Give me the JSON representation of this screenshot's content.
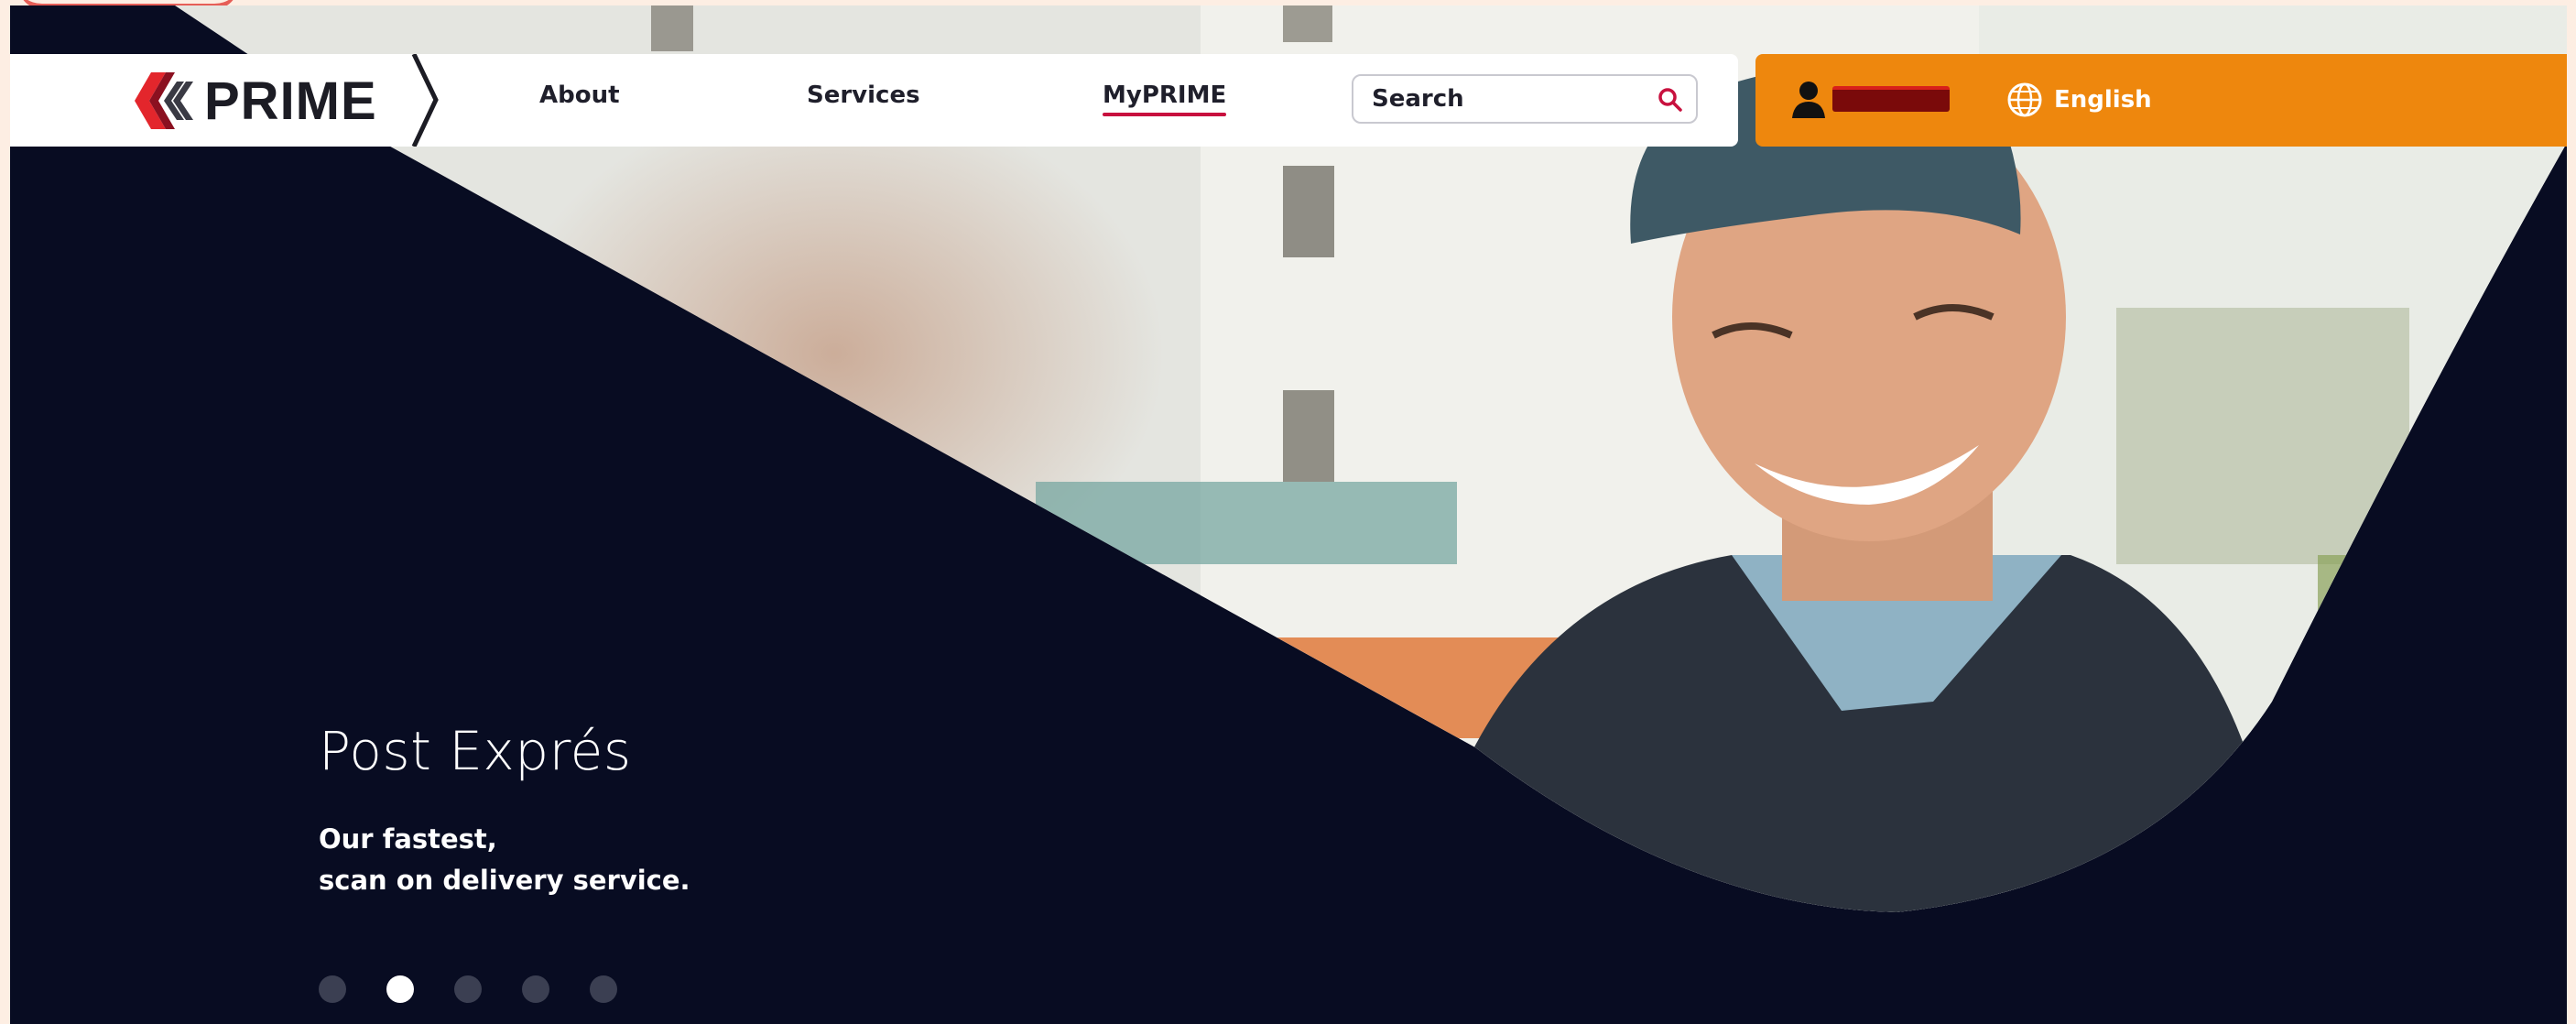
{
  "brand": {
    "name": "PRIME",
    "accent_color": "#c8103e",
    "orange_color": "#ee870d"
  },
  "nav": {
    "links": [
      {
        "label": "About"
      },
      {
        "label": "Services"
      },
      {
        "label": "MyPRIME",
        "active": true
      }
    ],
    "search": {
      "placeholder": "Search",
      "icon": "search-icon"
    }
  },
  "account": {
    "user_icon": "user-icon",
    "language_icon": "globe-icon",
    "language": "English"
  },
  "hero": {
    "title": "Post Exprés",
    "subtitle_line1": "Our fastest,",
    "subtitle_line2": "scan on delivery service.",
    "slides": {
      "count": 5,
      "active_index": 1
    }
  }
}
